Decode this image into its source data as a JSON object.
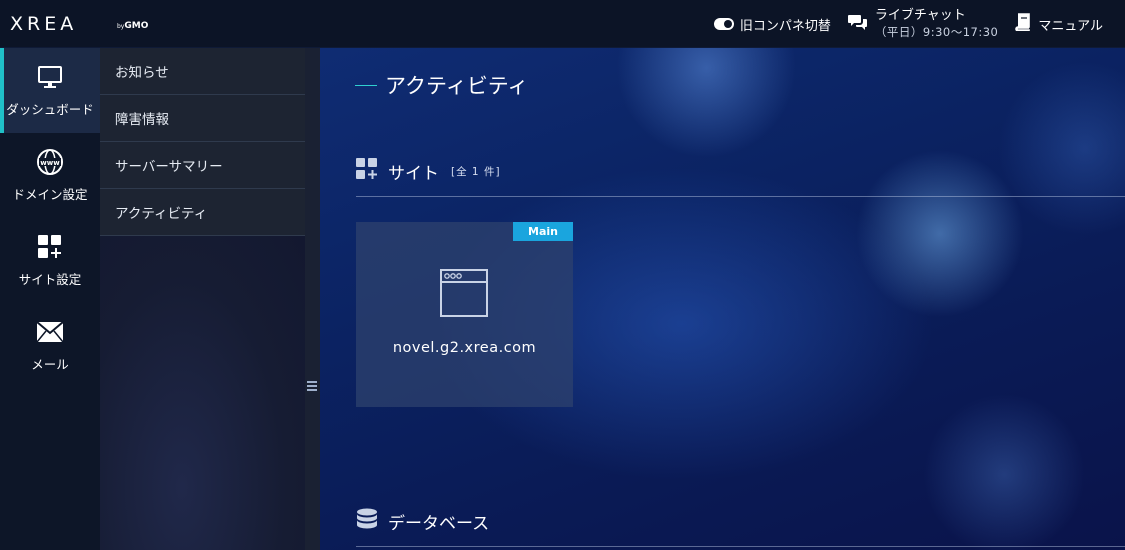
{
  "brand": {
    "logo": "XREA",
    "by": "by",
    "company": "GMO"
  },
  "header": {
    "old_panel_toggle": "旧コンパネ切替",
    "live_chat": "ライブチャット",
    "live_chat_hours": "（平日）9:30〜17:30",
    "manual": "マニュアル"
  },
  "nav": {
    "dashboard": "ダッシュボード",
    "domain": "ドメイン設定",
    "site": "サイト設定",
    "mail": "メール"
  },
  "submenu": {
    "items": [
      "お知らせ",
      "障害情報",
      "サーバーサマリー",
      "アクティビティ"
    ]
  },
  "main": {
    "title": "アクティビティ",
    "site_section": {
      "label": "サイト",
      "count": "[全 1 件]"
    },
    "site_card": {
      "badge": "Main",
      "domain": "novel.g2.xrea.com"
    },
    "db_section": {
      "label": "データベース"
    }
  },
  "colors": {
    "accent": "#20c0c8",
    "badge": "#1aa5de",
    "topbar": "#0c1426",
    "sidebar": "#0d1628"
  }
}
